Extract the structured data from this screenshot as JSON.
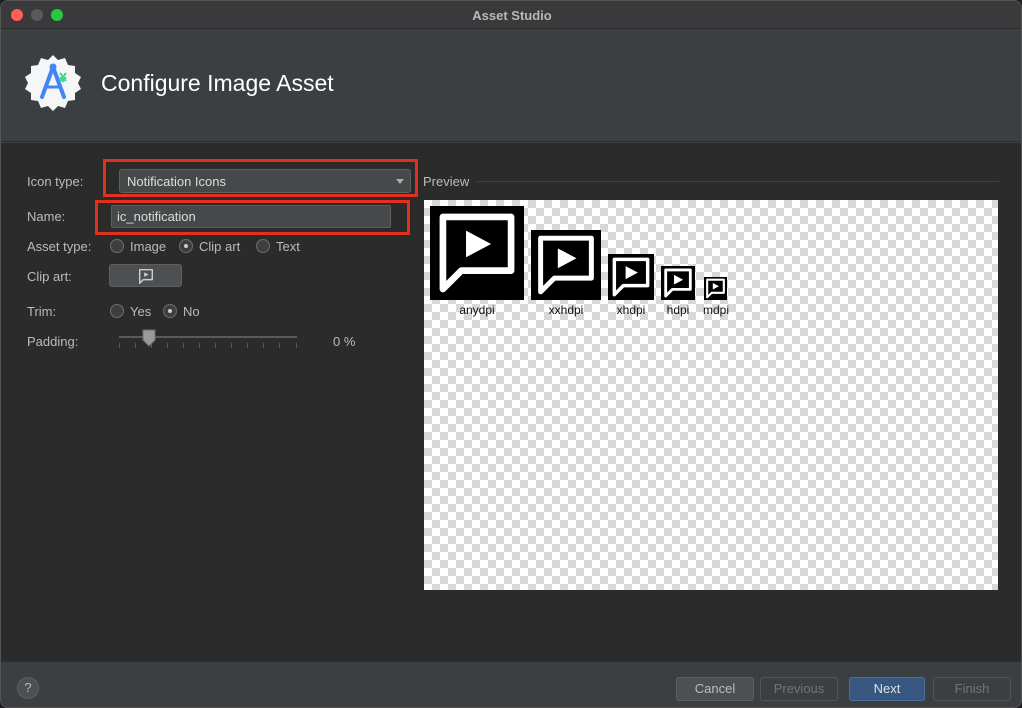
{
  "window": {
    "title": "Asset Studio"
  },
  "header": {
    "title": "Configure Image Asset",
    "logo_icon": "android-studio-logo-icon"
  },
  "form": {
    "icon_type_label": "Icon type:",
    "icon_type_value": "Notification Icons",
    "name_label": "Name:",
    "name_value": "ic_notification",
    "asset_type_label": "Asset type:",
    "asset_type_options": [
      "Image",
      "Clip art",
      "Text"
    ],
    "asset_type_selected": "Clip art",
    "clip_art_label": "Clip art:",
    "clip_art_icon": "slideshow-icon",
    "trim_label": "Trim:",
    "trim_options": [
      "Yes",
      "No"
    ],
    "trim_selected": "No",
    "padding_label": "Padding:",
    "padding_value": "0 %",
    "padding_percent": 0
  },
  "preview": {
    "label": "Preview",
    "densities": [
      "anydpi",
      "xxhdpi",
      "xhdpi",
      "hdpi",
      "mdpi"
    ],
    "icon": "slideshow-icon"
  },
  "footer": {
    "help_label": "?",
    "cancel": "Cancel",
    "previous": "Previous",
    "next": "Next",
    "finish": "Finish"
  },
  "colors": {
    "highlight": "#e0301e",
    "primary_button": "#365880"
  }
}
